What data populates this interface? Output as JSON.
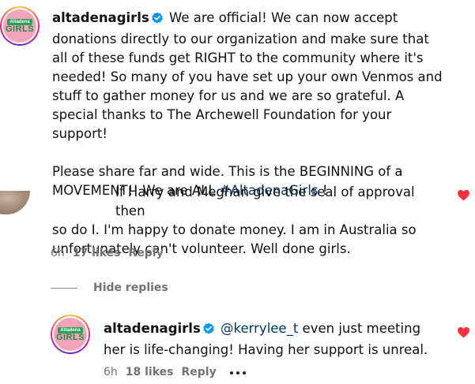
{
  "post": {
    "username": "altadenagirls",
    "avatar_logo_top": "Altadena",
    "avatar_logo_bottom": "GIRLS",
    "caption_p1": "We are official! We can now accept donations directly to our organization and make sure that all of these funds get RIGHT to the community where it's needed! So many of you have set up your own Venmos and stuff to gather money for us and we are so grateful. A special thanks to The Archewell Foundation for your support!",
    "caption_p2_prefix": "Please share far and wide. This is the BEGINNING of a MOVEMENT!! We are ALL ",
    "caption_hashtag": "#AltadenaGirls",
    "caption_p2_suffix": " !"
  },
  "comment": {
    "text_line1": "If Harry and Meghan give the seal of approval then",
    "text_rest": "so do I. I'm happy to donate money. I am in Australia so unfortunately can't volunteer. Well done girls.",
    "time": "6h",
    "likes": "17 likes",
    "reply_label": "Reply",
    "liked_icon": "heart-icon",
    "accent": "#ff3040"
  },
  "replies": {
    "toggle_label": "Hide replies"
  },
  "reply": {
    "username": "altadenagirls",
    "avatar_logo_top": "Altadena",
    "avatar_logo_bottom": "GIRLS",
    "mention": "@kerrylee_t",
    "text": " even just meeting her is life-changing! Having her support is unreal.",
    "time": "6h",
    "likes": "18 likes",
    "reply_label": "Reply",
    "more_icon": "more-options-icon"
  },
  "colors": {
    "verified": "#0095f6",
    "link": "#00376b",
    "muted": "#737373",
    "heart": "#ff3040"
  }
}
